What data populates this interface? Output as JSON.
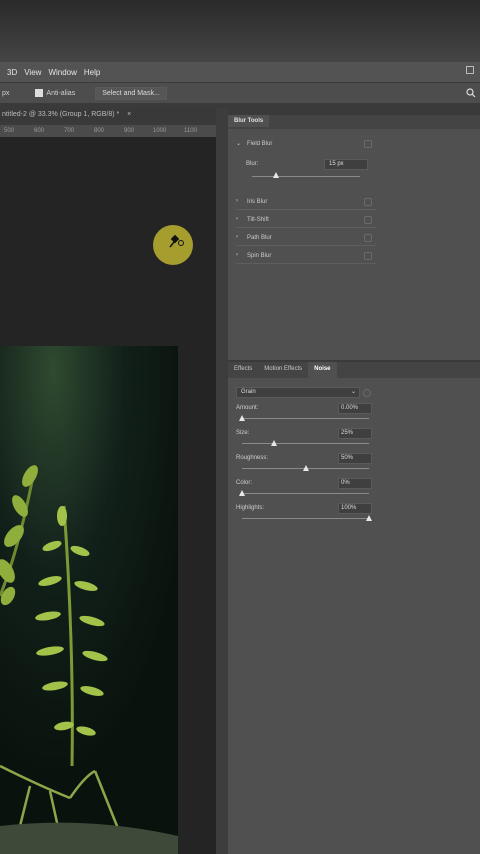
{
  "menubar": {
    "items": [
      "3D",
      "View",
      "Window",
      "Help"
    ]
  },
  "options": {
    "left_value": "px",
    "antialias_label": "Anti-alias",
    "select_mask_label": "Select and Mask..."
  },
  "document": {
    "tab_title": "ntitled-2 @ 33.3% (Group 1, RGB/8) *",
    "tab_close": "×"
  },
  "ruler": {
    "ticks": [
      "500",
      "600",
      "700",
      "800",
      "900",
      "1000",
      "1100"
    ]
  },
  "blur_tools": {
    "title": "Blur Tools",
    "field_blur": "Field Blur",
    "blur_label": "Blur:",
    "blur_value": "15 px",
    "items": [
      "Iris Blur",
      "Tilt-Shift",
      "Path Blur",
      "Spin Blur"
    ]
  },
  "effects": {
    "tabs": [
      "Effects",
      "Motion Effects",
      "Noise"
    ],
    "active_tab": "Noise",
    "dropdown": "Grain",
    "amount_label": "Amount:",
    "amount_value": "0.00%",
    "amount_level": 0.0,
    "size_label": "Size:",
    "size_value": "25%",
    "size_level": 0.25,
    "roughness_label": "Roughness:",
    "roughness_value": "50%",
    "roughness_level": 0.5,
    "color_label": "Color:",
    "color_value": "0%",
    "color_level": 0.0,
    "highlights_label": "Highlights:",
    "highlights_value": "100%",
    "highlights_level": 1.0
  },
  "colors": {
    "cursor_ring": "#d7cd32",
    "panel": "#505050",
    "canvas": "#242424"
  },
  "icons": {
    "search": "search-icon",
    "cursor": "pin-cursor-icon"
  }
}
